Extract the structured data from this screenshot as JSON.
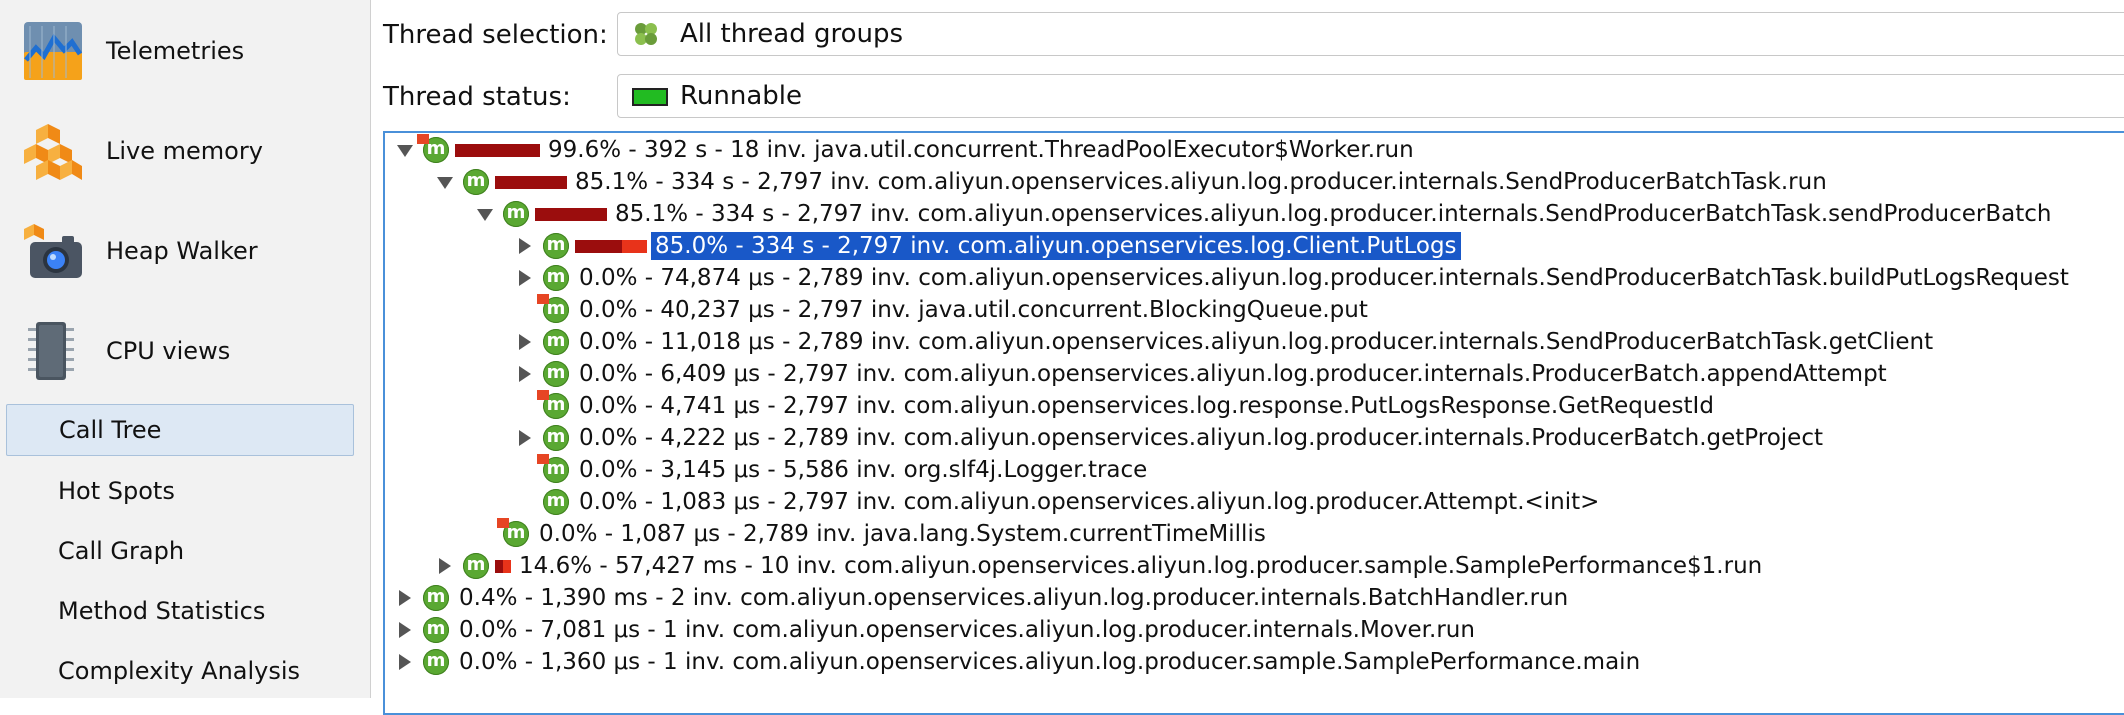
{
  "sidebar": {
    "items": [
      {
        "label": "Telemetries",
        "icon": "telemetries-chart-icon"
      },
      {
        "label": "Live memory",
        "icon": "live-memory-blocks-icon"
      },
      {
        "label": "Heap Walker",
        "icon": "heap-walker-camera-icon"
      },
      {
        "label": "CPU views",
        "icon": "cpu-chip-icon"
      }
    ],
    "sub_items": [
      {
        "label": "Call Tree",
        "selected": true
      },
      {
        "label": "Hot Spots",
        "selected": false
      },
      {
        "label": "Call Graph",
        "selected": false
      },
      {
        "label": "Method Statistics",
        "selected": false
      },
      {
        "label": "Complexity Analysis",
        "selected": false
      }
    ]
  },
  "thread_selection": {
    "label": "Thread selection:",
    "value": "All thread groups",
    "icon": "thread-groups-icon"
  },
  "thread_status": {
    "label": "Thread status:",
    "value": "Runnable",
    "icon": "runnable-status-icon",
    "status_color": "#22bb22"
  },
  "tree": {
    "rows": [
      {
        "text": "99.6% - 392 s - 18 inv. java.util.concurrent.ThreadPoolExecutor$Worker.run",
        "depth": 0,
        "toggle": "expanded",
        "icon": "method-icon",
        "flag": true,
        "bar_fraction": 0.996,
        "selected": false
      },
      {
        "text": "85.1% - 334 s - 2,797 inv. com.aliyun.openservices.aliyun.log.producer.internals.SendProducerBatchTask.run",
        "depth": 1,
        "toggle": "expanded",
        "icon": "method-icon",
        "flag": false,
        "bar_fraction": 0.851,
        "selected": false
      },
      {
        "text": "85.1% - 334 s - 2,797 inv. com.aliyun.openservices.aliyun.log.producer.internals.SendProducerBatchTask.sendProducerBatch",
        "depth": 2,
        "toggle": "expanded",
        "icon": "method-icon",
        "flag": false,
        "bar_fraction": 0.851,
        "selected": false
      },
      {
        "text": "85.0% - 334 s - 2,797 inv. com.aliyun.openservices.log.Client.PutLogs",
        "depth": 3,
        "toggle": "collapsed",
        "icon": "method-icon",
        "flag": false,
        "bar_fraction": 0.85,
        "bar_self_fraction": 0.35,
        "selected": true
      },
      {
        "text": "0.0% - 74,874 μs - 2,789 inv. com.aliyun.openservices.aliyun.log.producer.internals.SendProducerBatchTask.buildPutLogsRequest",
        "depth": 3,
        "toggle": "collapsed",
        "icon": "method-icon",
        "flag": false,
        "bar_fraction": 0,
        "selected": false
      },
      {
        "text": "0.0% - 40,237 μs - 2,797 inv. java.util.concurrent.BlockingQueue.put",
        "depth": 3,
        "toggle": "none",
        "icon": "method-icon",
        "flag": true,
        "bar_fraction": 0,
        "selected": false
      },
      {
        "text": "0.0% - 11,018 μs - 2,789 inv. com.aliyun.openservices.aliyun.log.producer.internals.SendProducerBatchTask.getClient",
        "depth": 3,
        "toggle": "collapsed",
        "icon": "method-icon",
        "flag": false,
        "bar_fraction": 0,
        "selected": false
      },
      {
        "text": "0.0% - 6,409 μs - 2,797 inv. com.aliyun.openservices.aliyun.log.producer.internals.ProducerBatch.appendAttempt",
        "depth": 3,
        "toggle": "collapsed",
        "icon": "method-icon",
        "flag": false,
        "bar_fraction": 0,
        "selected": false
      },
      {
        "text": "0.0% - 4,741 μs - 2,797 inv. com.aliyun.openservices.log.response.PutLogsResponse.GetRequestId",
        "depth": 3,
        "toggle": "none",
        "icon": "method-icon",
        "flag": true,
        "bar_fraction": 0,
        "selected": false
      },
      {
        "text": "0.0% - 4,222 μs - 2,789 inv. com.aliyun.openservices.aliyun.log.producer.internals.ProducerBatch.getProject",
        "depth": 3,
        "toggle": "collapsed",
        "icon": "method-icon",
        "flag": false,
        "bar_fraction": 0,
        "selected": false
      },
      {
        "text": "0.0% - 3,145 μs - 5,586 inv. org.slf4j.Logger.trace",
        "depth": 3,
        "toggle": "none",
        "icon": "method-icon",
        "flag": true,
        "bar_fraction": 0,
        "selected": false
      },
      {
        "text": "0.0% - 1,083 μs - 2,797 inv. com.aliyun.openservices.aliyun.log.producer.Attempt.<init>",
        "depth": 3,
        "toggle": "none",
        "icon": "method-icon",
        "flag": false,
        "bar_fraction": 0,
        "selected": false
      },
      {
        "text": "0.0% - 1,087 μs - 2,789 inv. java.lang.System.currentTimeMillis",
        "depth": 2,
        "toggle": "none",
        "icon": "method-icon",
        "flag": true,
        "bar_fraction": 0,
        "selected": false
      },
      {
        "text": "14.6% - 57,427 ms - 10 inv. com.aliyun.openservices.aliyun.log.producer.sample.SamplePerformance$1.run",
        "depth": 1,
        "toggle": "collapsed",
        "icon": "method-icon",
        "flag": false,
        "bar_fraction": 0.146,
        "bar_self_fraction": 0.5,
        "selected": false
      },
      {
        "text": "0.4% - 1,390 ms - 2 inv. com.aliyun.openservices.aliyun.log.producer.internals.BatchHandler.run",
        "depth": 0,
        "toggle": "collapsed",
        "icon": "method-icon",
        "flag": false,
        "bar_fraction": 0,
        "selected": false
      },
      {
        "text": "0.0% - 7,081 μs - 1 inv. com.aliyun.openservices.aliyun.log.producer.internals.Mover.run",
        "depth": 0,
        "toggle": "collapsed",
        "icon": "method-icon",
        "flag": false,
        "bar_fraction": 0,
        "selected": false
      },
      {
        "text": "0.0% - 1,360 μs - 1 inv. com.aliyun.openservices.aliyun.log.producer.sample.SamplePerformance.main",
        "depth": 0,
        "toggle": "collapsed",
        "icon": "method-icon",
        "flag": false,
        "bar_fraction": 0,
        "selected": false
      }
    ]
  },
  "colors": {
    "bar": "#9b0d0d",
    "bar_self": "#e8331a",
    "selection": "#1958c8",
    "method_icon": "#5aa832"
  }
}
